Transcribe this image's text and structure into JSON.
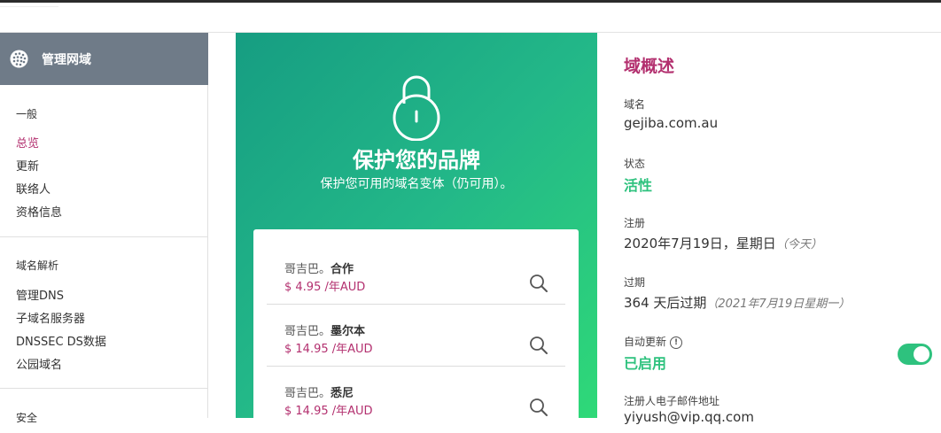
{
  "sidebar": {
    "title": "管理网域",
    "sections": [
      {
        "heading": "一般",
        "items": [
          "总览",
          "更新",
          "联络人",
          "资格信息"
        ]
      },
      {
        "heading": "域名解析",
        "items": [
          "管理DNS",
          "子域名服务器",
          "DNSSEC DS数据",
          "公园域名"
        ]
      },
      {
        "heading": "安全"
      }
    ]
  },
  "hero": {
    "title": "保护您的品牌",
    "subtitle": "保护您可用的域名变体（仍可用）。",
    "suggestions": [
      {
        "prefix": "哥吉巴。",
        "suffix": "合作",
        "price": "$ 4.95 /年AUD"
      },
      {
        "prefix": "哥吉巴。",
        "suffix": "墨尔本",
        "price": "$ 14.95 /年AUD"
      },
      {
        "prefix": "哥吉巴。",
        "suffix": "悉尼",
        "price": "$ 14.95 /年AUD"
      }
    ]
  },
  "overview": {
    "title": "域概述",
    "domain_label": "域名",
    "domain_value": "gejiba.com.au",
    "status_label": "状态",
    "status_value": "活性",
    "registered_label": "注册",
    "registered_value": "2020年7月19日，星期日",
    "registered_note": "（今天）",
    "expiry_label": "过期",
    "expiry_value": "364 天后过期",
    "expiry_note": "（2021年7月19日星期一）",
    "autorenew_label": "自动更新",
    "autorenew_value": "已启用",
    "autorenew_enabled": true,
    "registrant_email_label": "注册人电子邮件地址",
    "registrant_email_value": "yiyush@vip.qq.com"
  },
  "colors": {
    "accent": "#b3306f",
    "green": "#2ec27e",
    "sidebar_header": "#6f7b88"
  }
}
